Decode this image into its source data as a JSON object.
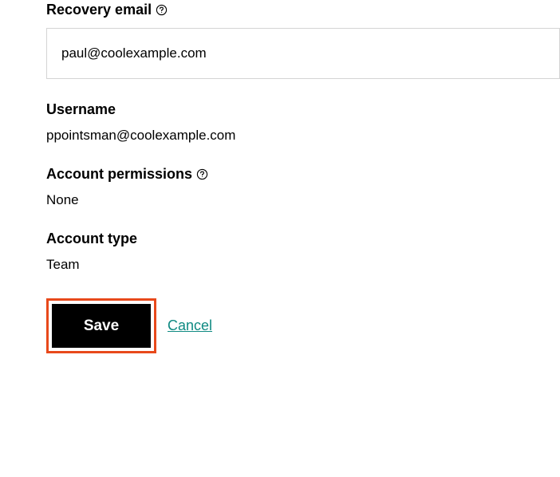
{
  "recovery_email": {
    "label": "Recovery email",
    "value": "paul@coolexample.com"
  },
  "username": {
    "label": "Username",
    "value": "ppointsman@coolexample.com"
  },
  "account_permissions": {
    "label": "Account permissions",
    "value": "None"
  },
  "account_type": {
    "label": "Account type",
    "value": "Team"
  },
  "buttons": {
    "save_label": "Save",
    "cancel_label": "Cancel"
  }
}
